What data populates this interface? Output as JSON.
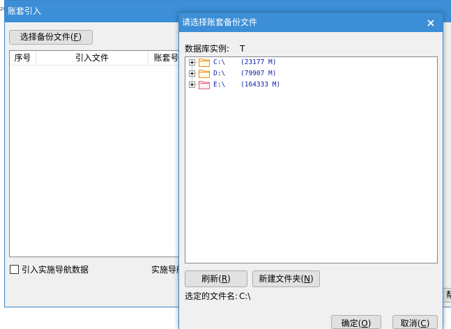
{
  "desktop": {
    "edge_text": "20"
  },
  "main_window": {
    "title": "账套引入",
    "select_backup_button": "选择备份文件(F)",
    "file_list": {
      "columns": [
        "序号",
        "引入文件",
        "账套号"
      ],
      "rows": []
    },
    "import_nav_checkbox": {
      "label": "引入实施导航数据",
      "checked": false
    },
    "nav_caption": "实施导航",
    "edge_button_label": "帮"
  },
  "dialog": {
    "title": "请选择账套备份文件",
    "close_icon": "close-icon",
    "db_instance": {
      "label": "数据库实例:",
      "value": "T"
    },
    "drives": [
      {
        "name": "C:\\",
        "size": "(23177 M)",
        "expanded": false,
        "icon": "folder-icon",
        "icon_color": "#e8900c"
      },
      {
        "name": "D:\\",
        "size": "(79907 M)",
        "expanded": false,
        "icon": "folder-icon",
        "icon_color": "#e8900c"
      },
      {
        "name": "E:\\",
        "size": "(164333 M)",
        "expanded": false,
        "icon": "folder-icon",
        "icon_color": "#e0607a"
      }
    ],
    "refresh_button": "刷新(R)",
    "new_folder_button": "新建文件夹(N)",
    "selected_file": {
      "label": "选定的文件名:",
      "value": "C:\\"
    },
    "ok_button": "确定(O)",
    "cancel_button": "取消(C)"
  },
  "colors": {
    "title_bar": "#3c8fd6",
    "window_frame": "#3a86cc",
    "panel": "#f0f0f0",
    "tree_text": "#0a1aa8"
  }
}
